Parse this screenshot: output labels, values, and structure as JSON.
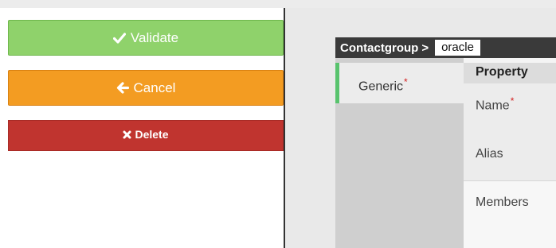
{
  "actions": {
    "validate_label": "Validate",
    "cancel_label": "Cancel",
    "delete_label": "Delete"
  },
  "form": {
    "object_type": "Contactgroup",
    "separator": ">",
    "object_name": "oracle"
  },
  "tabs": [
    {
      "label": "Generic",
      "required": "*"
    }
  ],
  "table": {
    "header": "Property",
    "rows": [
      {
        "label": "Name",
        "required": "*"
      },
      {
        "label": "Alias"
      },
      {
        "label": "Members"
      }
    ]
  },
  "colors": {
    "validate": "#8fd26b",
    "cancel": "#f39c22",
    "delete": "#c0342f",
    "active_tab_accent": "#58c36d",
    "header_bg": "#3a3a3a"
  }
}
